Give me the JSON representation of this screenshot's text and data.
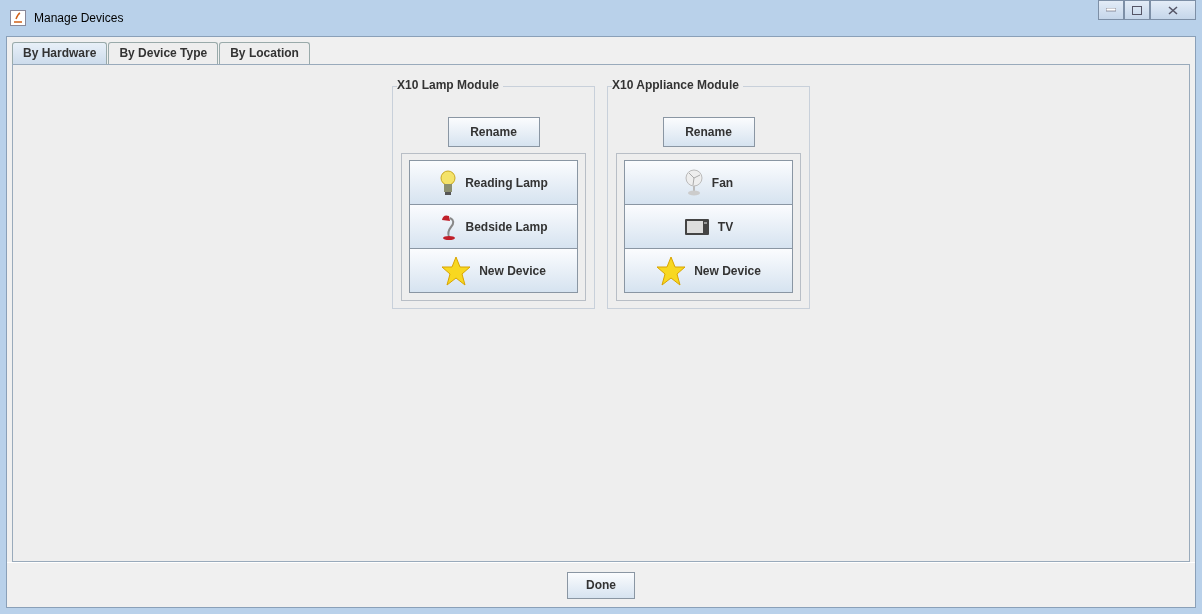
{
  "window": {
    "title": "Manage Devices"
  },
  "tabs": [
    {
      "label": "By Hardware",
      "selected": true
    },
    {
      "label": "By Device Type",
      "selected": false
    },
    {
      "label": "By Location",
      "selected": false
    }
  ],
  "modules": [
    {
      "title": "X10 Lamp Module",
      "rename_button": "Rename",
      "devices": [
        {
          "label": "Reading Lamp",
          "kind": "bulb"
        },
        {
          "label": "Bedside Lamp",
          "kind": "desklamp"
        },
        {
          "label": "New Device",
          "kind": "star"
        }
      ]
    },
    {
      "title": "X10 Appliance Module",
      "rename_button": "Rename",
      "devices": [
        {
          "label": "Fan",
          "kind": "fan"
        },
        {
          "label": "TV",
          "kind": "tv"
        },
        {
          "label": "New Device",
          "kind": "star"
        }
      ]
    }
  ],
  "done_button": "Done"
}
